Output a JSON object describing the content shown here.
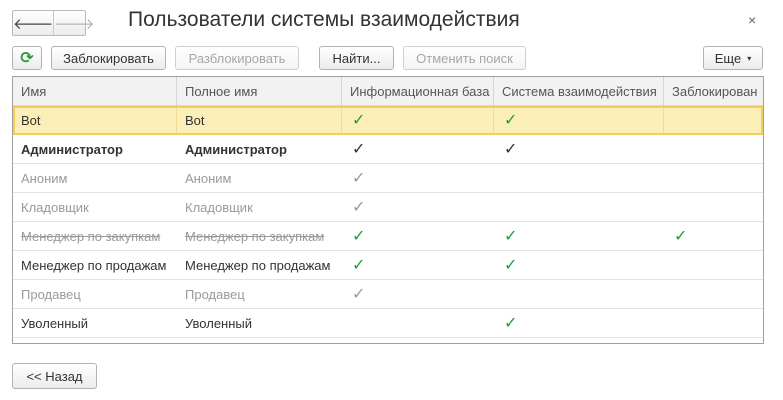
{
  "nav": {
    "back_glyph": "🡐",
    "forward_glyph": "🡒"
  },
  "title": "Пользователи системы взаимодействия",
  "close_glyph": "×",
  "toolbar": {
    "refresh_glyph": "⟳",
    "block_label": "Заблокировать",
    "unblock_label": "Разблокировать",
    "find_label": "Найти...",
    "cancel_search_label": "Отменить поиск",
    "more_label": "Еще",
    "more_caret": "▾"
  },
  "table": {
    "columns": [
      "Имя",
      "Полное имя",
      "Информационная база",
      "Система взаимодействия",
      "Заблокирован"
    ],
    "check_glyph": "✓",
    "rows": [
      {
        "name": "Bot",
        "full_name": "Bot",
        "infobase": "✓",
        "interaction": "✓",
        "blocked": ""
      },
      {
        "name": "Администратор",
        "full_name": "Администратор",
        "infobase": "✓",
        "interaction": "✓",
        "blocked": ""
      },
      {
        "name": "Аноним",
        "full_name": "Аноним",
        "infobase": "✓",
        "interaction": "",
        "blocked": ""
      },
      {
        "name": "Кладовщик",
        "full_name": "Кладовщик",
        "infobase": "✓",
        "interaction": "",
        "blocked": ""
      },
      {
        "name": "Менеджер по закупкам",
        "full_name": "Менеджер по закупкам",
        "infobase": "✓",
        "interaction": "✓",
        "blocked": "✓"
      },
      {
        "name": "Менеджер по продажам",
        "full_name": "Менеджер по продажам",
        "infobase": "✓",
        "interaction": "✓",
        "blocked": ""
      },
      {
        "name": "Продавец",
        "full_name": "Продавец",
        "infobase": "✓",
        "interaction": "",
        "blocked": ""
      },
      {
        "name": "Уволенный",
        "full_name": "Уволенный",
        "infobase": "",
        "interaction": "✓",
        "blocked": ""
      }
    ]
  },
  "footer": {
    "back_label": "<< Назад"
  }
}
